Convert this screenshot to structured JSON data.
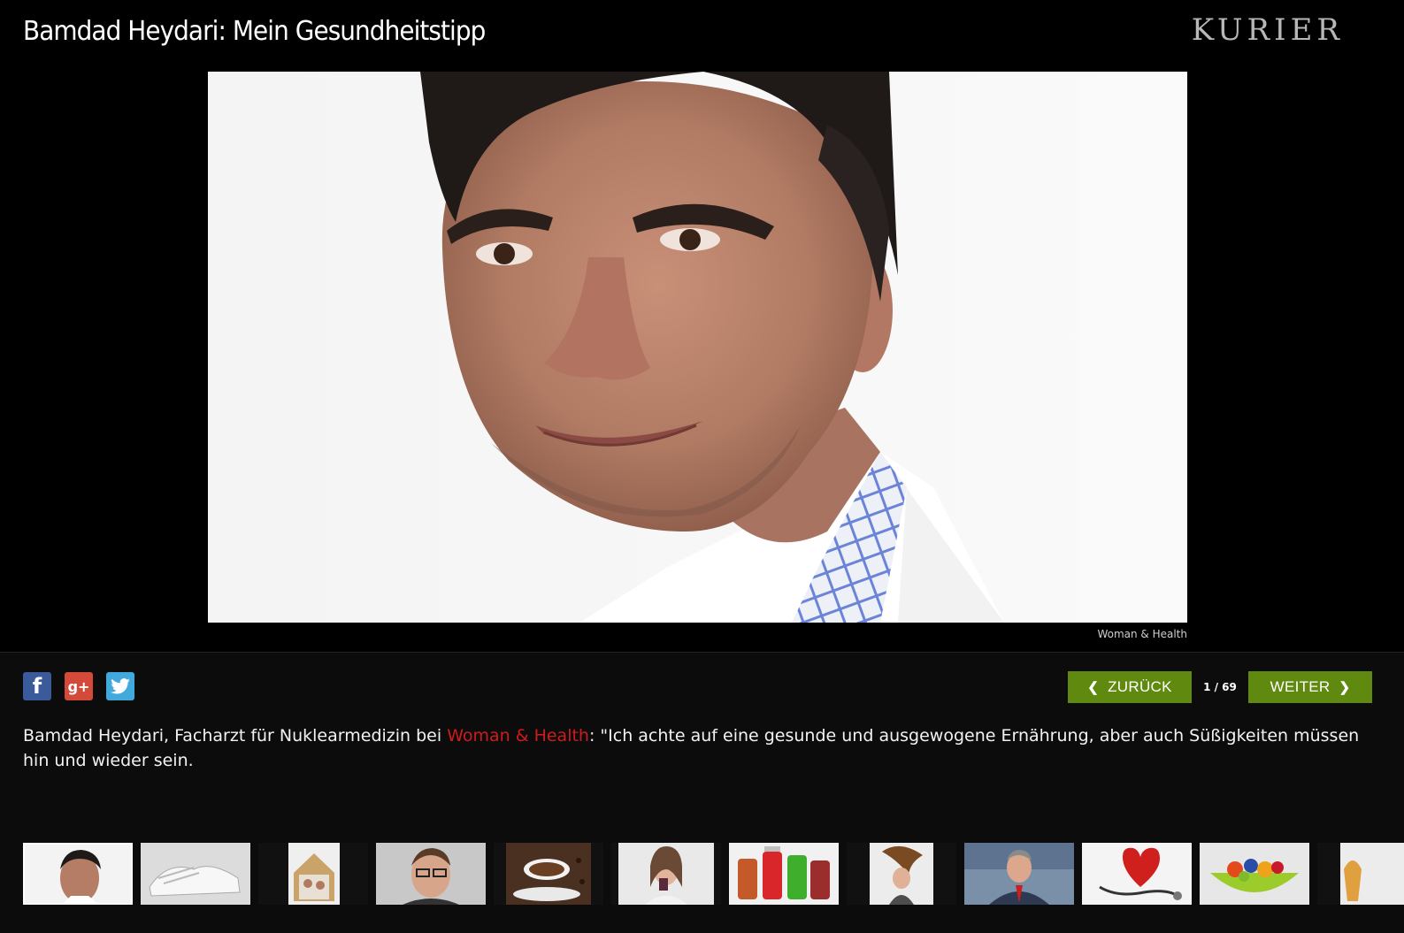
{
  "header": {
    "title": "Bamdad Heydari: Mein Gesundheitstipp",
    "logo": "KURIER"
  },
  "photo": {
    "credit": "Woman & Health"
  },
  "social": {
    "icons": [
      "facebook-icon",
      "google-plus-icon",
      "twitter-icon"
    ],
    "facebook_glyph": "f",
    "googleplus_glyph": "g+"
  },
  "nav": {
    "prev_label": "ZURÜCK",
    "next_label": "WEITER",
    "counter": "1 / 69"
  },
  "caption": {
    "before": "Bamdad Heydari, Facharzt für Nuklearmedizin bei ",
    "link": "Woman & Health",
    "after": ": \"Ich achte auf eine gesunde und ausgewogene Ernährung, aber auch Süßigkeiten müssen hin und wieder sein."
  },
  "colors": {
    "background": "#000000",
    "panel": "#0c0c0c",
    "button_green": "#5f8a0f",
    "link_red": "#d01b1b",
    "facebook": "#3b5a9a",
    "googleplus": "#d34a3b",
    "twitter": "#41a9dc"
  },
  "thumbnails": [
    {
      "name": "thumb-doctor-portrait",
      "active": true
    },
    {
      "name": "thumb-sneakers",
      "active": false
    },
    {
      "name": "thumb-house-family",
      "active": false
    },
    {
      "name": "thumb-man-glasses",
      "active": false
    },
    {
      "name": "thumb-coffee-cup",
      "active": false
    },
    {
      "name": "thumb-woman-drinking",
      "active": false
    },
    {
      "name": "thumb-juice-bottles",
      "active": false
    },
    {
      "name": "thumb-woman-hair",
      "active": false
    },
    {
      "name": "thumb-businessman",
      "active": false
    },
    {
      "name": "thumb-heart-stethoscope",
      "active": false
    },
    {
      "name": "thumb-fruit-bowl",
      "active": false
    },
    {
      "name": "thumb-partial",
      "active": false
    }
  ]
}
